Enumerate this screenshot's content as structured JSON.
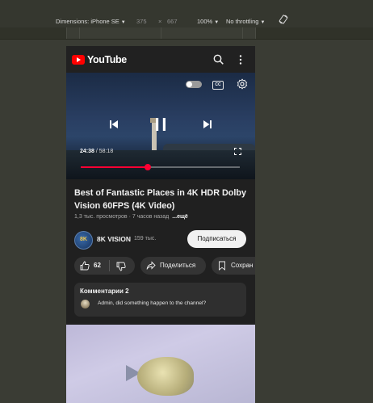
{
  "devtools": {
    "dimensions_label": "Dimensions: iPhone SE",
    "width": "375",
    "times": "×",
    "height": "667",
    "zoom": "100%",
    "throttling": "No throttling",
    "rotate_icon": "rotate-icon"
  },
  "youtube": {
    "logo_text": "YouTube",
    "header_icons": [
      "search-icon",
      "more-vert-icon"
    ],
    "player": {
      "current_time": "24:38",
      "separator": " / ",
      "duration": "58:18",
      "progress_fraction": 0.42,
      "icons": [
        "autoplay-toggle",
        "cc-icon",
        "gear-icon",
        "previous-icon",
        "pause-icon",
        "next-icon",
        "fullscreen-icon"
      ],
      "cc_text": "CC"
    },
    "video": {
      "title": "Best of Fantastic Places in 4K HDR Dolby Vision 60FPS (4K Video)",
      "meta": "1,3 тыс. просмотров · 7 часов назад",
      "more": "...ещё"
    },
    "channel": {
      "avatar_text": "8K",
      "name": "8K VISION",
      "subscribers": "159 тыс.",
      "subscribe_label": "Подписаться"
    },
    "actions": {
      "like_count": "62",
      "share_label": "Поделиться",
      "save_label": "Сохран"
    },
    "comments": {
      "title": "Комментарии 2",
      "top_comment": "Admin, did something happen to the channel?"
    }
  },
  "colors": {
    "accent_red": "#ff0033",
    "page_bg": "#202020",
    "devtools_bg": "#35372f"
  }
}
